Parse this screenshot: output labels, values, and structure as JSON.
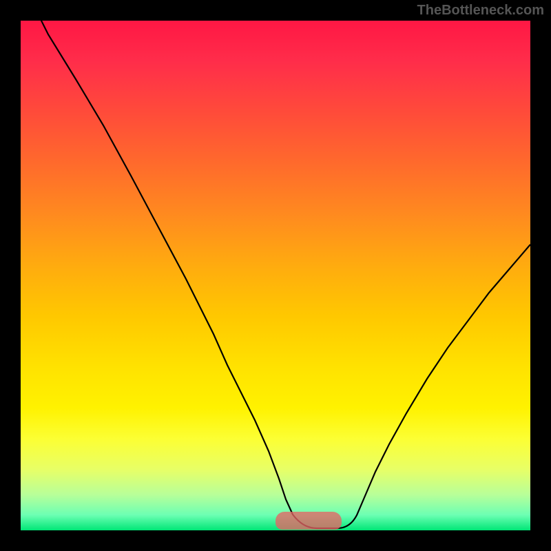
{
  "watermark": "TheBottleneck.com",
  "chart_data": {
    "type": "line",
    "title": "",
    "xlabel": "",
    "ylabel": "",
    "xlim": [
      0,
      100
    ],
    "ylim": [
      0,
      100
    ],
    "series": [
      {
        "name": "curve",
        "x": [
          0,
          5,
          10,
          15,
          20,
          25,
          30,
          35,
          40,
          45,
          50,
          52,
          55,
          58,
          60,
          63,
          66,
          70,
          75,
          80,
          85,
          90,
          95,
          100
        ],
        "y": [
          108,
          100,
          91,
          82,
          72,
          62,
          52,
          41,
          30,
          18,
          6,
          2,
          0.5,
          0.3,
          0.5,
          2,
          6,
          14,
          23,
          32,
          40,
          47,
          53,
          58
        ]
      }
    ],
    "highlight_band": {
      "x_start": 50,
      "x_end": 63,
      "color": "#e06a6a"
    },
    "background_gradient": [
      "#ff1744",
      "#ffc800",
      "#fff200",
      "#00e676"
    ]
  }
}
